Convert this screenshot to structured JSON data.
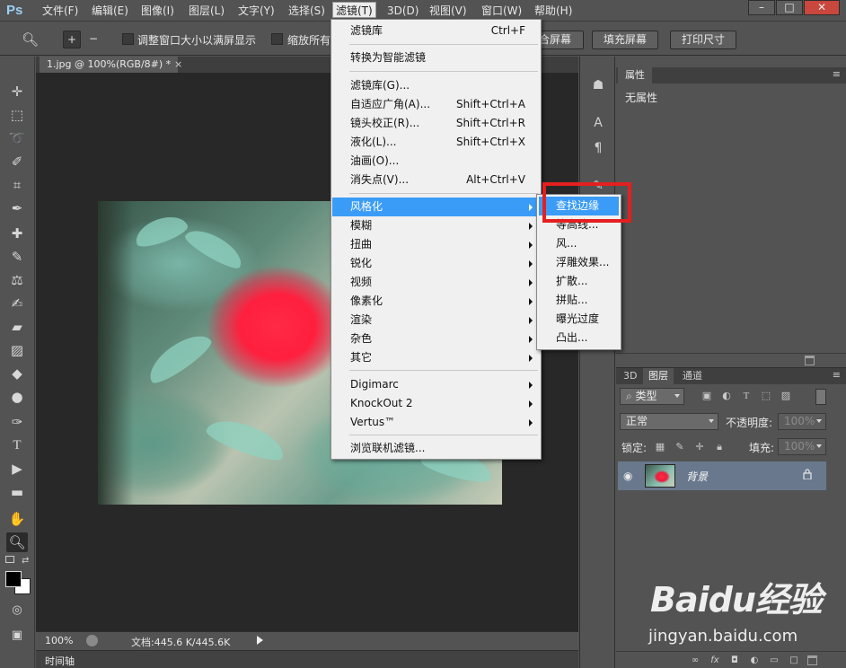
{
  "app": {
    "logo": "Ps"
  },
  "menubar": {
    "items": [
      "文件(F)",
      "编辑(E)",
      "图像(I)",
      "图层(L)",
      "文字(Y)",
      "选择(S)",
      "滤镜(T)",
      "3D(D)",
      "视图(V)",
      "窗口(W)",
      "帮助(H)"
    ],
    "active_index": 6
  },
  "window_controls": {
    "minimize": "–",
    "maximize": "□",
    "close": "✕"
  },
  "options": {
    "resize_label": "调整窗口大小以满屏显示",
    "zoom_all_label": "缩放所有",
    "fit_screen": "合屏幕",
    "fill_screen": "填充屏幕",
    "print_size": "打印尺寸"
  },
  "document": {
    "tab_title": "1.jpg @ 100%(RGB/8#) *",
    "close": "×"
  },
  "status": {
    "zoom": "100%",
    "doc_size": "文档:445.6 K/445.6K"
  },
  "timeline": {
    "label": "时间轴"
  },
  "properties": {
    "tab": "属性",
    "content": "无属性"
  },
  "layers": {
    "tabs": [
      "3D",
      "图层",
      "通道"
    ],
    "active_tab": 1,
    "filter_kind": "类型",
    "blend_mode": "正常",
    "opacity_label": "不透明度:",
    "opacity_value": "100%",
    "lock_label": "锁定:",
    "fill_label": "填充:",
    "fill_value": "100%",
    "items": [
      {
        "name": "背景",
        "visible": true,
        "locked": true
      }
    ]
  },
  "filter_menu": {
    "items": [
      {
        "label": "滤镜库",
        "shortcut": "Ctrl+F"
      },
      {
        "label": "转换为智能滤镜"
      },
      {
        "label": "滤镜库(G)..."
      },
      {
        "label": "自适应广角(A)...",
        "shortcut": "Shift+Ctrl+A"
      },
      {
        "label": "镜头校正(R)...",
        "shortcut": "Shift+Ctrl+R"
      },
      {
        "label": "液化(L)...",
        "shortcut": "Shift+Ctrl+X"
      },
      {
        "label": "油画(O)..."
      },
      {
        "label": "消失点(V)...",
        "shortcut": "Alt+Ctrl+V"
      },
      {
        "label": "风格化",
        "submenu": true,
        "highlighted": true
      },
      {
        "label": "模糊",
        "submenu": true
      },
      {
        "label": "扭曲",
        "submenu": true
      },
      {
        "label": "锐化",
        "submenu": true
      },
      {
        "label": "视频",
        "submenu": true
      },
      {
        "label": "像素化",
        "submenu": true
      },
      {
        "label": "渲染",
        "submenu": true
      },
      {
        "label": "杂色",
        "submenu": true
      },
      {
        "label": "其它",
        "submenu": true
      },
      {
        "label": "Digimarc",
        "submenu": true
      },
      {
        "label": "KnockOut 2",
        "submenu": true
      },
      {
        "label": "Vertus™",
        "submenu": true
      },
      {
        "label": "浏览联机滤镜..."
      }
    ]
  },
  "stylize_submenu": {
    "items": [
      "查找边缘",
      "等高线...",
      "风...",
      "浮雕效果...",
      "扩散...",
      "拼贴...",
      "曝光过度",
      "凸出..."
    ],
    "highlighted_index": 0
  },
  "watermark": {
    "logo": "Baidu经验",
    "url": "jingyan.baidu.com"
  },
  "colors": {
    "menu_highlight": "#3b9cf7",
    "annotation_box": "#e51f1f",
    "ui_background": "#535353",
    "canvas_background": "#282828"
  }
}
